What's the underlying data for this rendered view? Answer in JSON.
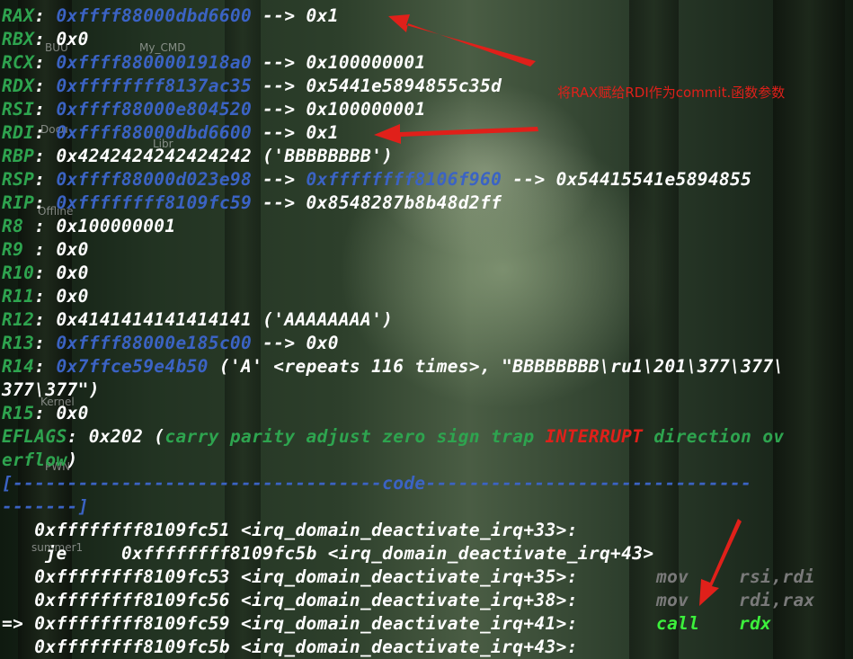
{
  "desktop_labels": [
    "BUU",
    "My_CMD",
    "Docu",
    "Libr",
    "Offline",
    "Kernel",
    "PWN",
    "summer1"
  ],
  "annotation": "将RAX赋给RDI作为commit.函数参数",
  "registers": [
    {
      "name": "RAX",
      "sep": ": ",
      "addr": "0xffff88000dbd6600",
      "rest": " --> 0x1"
    },
    {
      "name": "RBX",
      "sep": ": ",
      "addr": "",
      "rest": "0x0"
    },
    {
      "name": "RCX",
      "sep": ": ",
      "addr": "0xffff8800001918a0",
      "rest": " --> 0x100000001"
    },
    {
      "name": "RDX",
      "sep": ": ",
      "addr": "0xffffffff8137ac35",
      "rest": " --> 0x5441e5894855c35d"
    },
    {
      "name": "RSI",
      "sep": ": ",
      "addr": "0xffff88000e804520",
      "rest": " --> 0x100000001"
    },
    {
      "name": "RDI",
      "sep": ": ",
      "addr": "0xffff88000dbd6600",
      "rest": " --> 0x1"
    },
    {
      "name": "RBP",
      "sep": ": ",
      "addr": "",
      "rest": "0x4242424242424242 ('BBBBBBBB')"
    },
    {
      "name": "RSP",
      "sep": ": ",
      "addr": "0xffff88000d023e98",
      "rest": " --> ",
      "addr2": "0xffffffff8106f960",
      "rest2": " --> 0x54415541e5894855"
    },
    {
      "name": "RIP",
      "sep": ": ",
      "addr": "0xffffffff8109fc59",
      "rest": " --> 0x8548287b8b48d2ff"
    },
    {
      "name": "R8",
      "sep": " : ",
      "addr": "",
      "rest": "0x100000001"
    },
    {
      "name": "R9",
      "sep": " : ",
      "addr": "",
      "rest": "0x0"
    },
    {
      "name": "R10",
      "sep": ": ",
      "addr": "",
      "rest": "0x0"
    },
    {
      "name": "R11",
      "sep": ": ",
      "addr": "",
      "rest": "0x0"
    },
    {
      "name": "R12",
      "sep": ": ",
      "addr": "",
      "rest": "0x4141414141414141 ('AAAAAAAA')"
    },
    {
      "name": "R13",
      "sep": ": ",
      "addr": "0xffff88000e185c00",
      "rest": " --> 0x0"
    },
    {
      "name": "R14",
      "sep": ": ",
      "addr": "0x7ffce59e4b50",
      "rest": " ('A' <repeats 116 times>, \"BBBBBBBB\\ru1\\201\\377\\377\\"
    },
    {
      "name": "",
      "sep": "",
      "addr": "",
      "rest": "377\\377\")"
    },
    {
      "name": "R15",
      "sep": ": ",
      "addr": "",
      "rest": "0x0"
    }
  ],
  "eflags": {
    "name": "EFLAGS",
    "sep": ": ",
    "value": "0x202 (",
    "flags_a": "carry parity adjust zero sign trap ",
    "interrupt": "INTERRUPT",
    "flags_b": " direction ov",
    "wrap": "erflow",
    "close": ")"
  },
  "code_header": {
    "line1": "[----------------------------------code------------------------------",
    "line2": "-------]"
  },
  "code": [
    {
      "prefix": "   ",
      "text": "0xffffffff8109fc51 <irq_domain_deactivate_irq+33>:",
      "mnemonic": "",
      "operands": ""
    },
    {
      "prefix": "    ",
      "text": "je     0xffffffff8109fc5b <irq_domain_deactivate_irq+43>",
      "mnemonic": "",
      "operands": ""
    },
    {
      "prefix": "   ",
      "text": "0xffffffff8109fc53 <irq_domain_deactivate_irq+35>:",
      "mnemonic": "mov",
      "operands": "rsi,rdi"
    },
    {
      "prefix": "   ",
      "text": "0xffffffff8109fc56 <irq_domain_deactivate_irq+38>:",
      "mnemonic": "mov",
      "operands": "rdi,rax"
    },
    {
      "prefix": "=> ",
      "text": "0xffffffff8109fc59 <irq_domain_deactivate_irq+41>:",
      "mnemonic": "call",
      "operands": "rdx"
    },
    {
      "prefix": "   ",
      "text": "0xffffffff8109fc5b <irq_domain_deactivate_irq+43>:",
      "mnemonic": "",
      "operands": ""
    }
  ],
  "colors": {
    "register": "#2ea44f",
    "address": "#3b63c4",
    "value": "#ffffff",
    "interrupt": "#e0201a",
    "current_instr": "#3cf03c",
    "annotation": "#e0201a"
  }
}
